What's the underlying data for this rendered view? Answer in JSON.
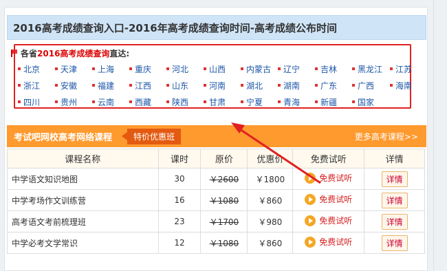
{
  "page_title": "2016高考成绩查询入口-2016年高考成绩查询时间-高考成绩公布时间",
  "province_section": {
    "head_prefix": "各省",
    "head_highlight": "2016高考成绩查询",
    "head_suffix": "直达:",
    "rows": [
      [
        "北京",
        "天津",
        "上海",
        "重庆",
        "河北",
        "山西",
        "内蒙古",
        "辽宁",
        "吉林",
        "黑龙江",
        "江苏"
      ],
      [
        "浙江",
        "安徽",
        "福建",
        "江西",
        "山东",
        "河南",
        "湖北",
        "湖南",
        "广东",
        "广西",
        "海南"
      ],
      [
        "四川",
        "贵州",
        "云南",
        "西藏",
        "陕西",
        "甘肃",
        "宁夏",
        "青海",
        "新疆",
        "国家"
      ]
    ]
  },
  "courses": {
    "title": "考试吧网校高考网络课程",
    "promo": "特价优惠班",
    "more": "更多高考课程>>",
    "columns": [
      "课程名称",
      "课时",
      "原价",
      "优惠价",
      "免费试听",
      "详情"
    ],
    "rows": [
      {
        "name": "中学语文知识地图",
        "hours": "30",
        "orig": "￥2600",
        "price": "￥1800",
        "try": "免费试听",
        "detail": "详情"
      },
      {
        "name": "中学考场作文训练营",
        "hours": "16",
        "orig": "￥1080",
        "price": "￥860",
        "try": "免费试听",
        "detail": "详情"
      },
      {
        "name": "高考语文考前梳理班",
        "hours": "23",
        "orig": "￥1700",
        "price": "￥980",
        "try": "免费试听",
        "detail": "详情"
      },
      {
        "name": "中学必考文学常识",
        "hours": "12",
        "orig": "￥1080",
        "price": "￥860",
        "try": "免费试听",
        "detail": "详情"
      }
    ]
  },
  "colors": {
    "accent_orange": "#ff9a2e",
    "highlight_red": "#e02020",
    "link_blue": "#1c56a8"
  }
}
